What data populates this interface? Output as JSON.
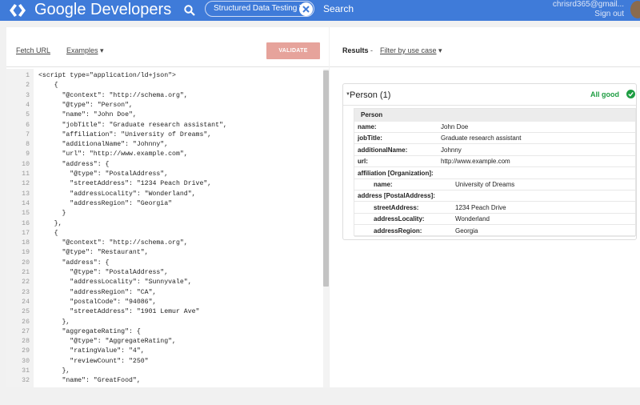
{
  "header": {
    "logo_text": "Google Developers",
    "tab_label": "Structured Data Testing T...",
    "search_label": "Search",
    "account_email": "chrisrd365@gmail...",
    "sign_out": "Sign out",
    "brand_color": "#3f7bd9"
  },
  "left": {
    "fetch_url": "Fetch URL",
    "examples": "Examples",
    "validate": "VALIDATE",
    "code_lines": [
      {
        "n": "1",
        "t": "<script type=\"application/ld+json\">"
      },
      {
        "n": "2",
        "t": "    {"
      },
      {
        "n": "3",
        "t": "      \"@context\": \"http://schema.org\","
      },
      {
        "n": "4",
        "t": "      \"@type\": \"Person\","
      },
      {
        "n": "5",
        "t": "      \"name\": \"John Doe\","
      },
      {
        "n": "6",
        "t": "      \"jobTitle\": \"Graduate research assistant\","
      },
      {
        "n": "7",
        "t": "      \"affiliation\": \"University of Dreams\","
      },
      {
        "n": "8",
        "t": "      \"additionalName\": \"Johnny\","
      },
      {
        "n": "9",
        "t": "      \"url\": \"http://www.example.com\","
      },
      {
        "n": "10",
        "t": "      \"address\": {"
      },
      {
        "n": "11",
        "t": "        \"@type\": \"PostalAddress\","
      },
      {
        "n": "12",
        "t": "        \"streetAddress\": \"1234 Peach Drive\","
      },
      {
        "n": "13",
        "t": "        \"addressLocality\": \"Wonderland\","
      },
      {
        "n": "14",
        "t": "        \"addressRegion\": \"Georgia\""
      },
      {
        "n": "15",
        "t": "      }"
      },
      {
        "n": "16",
        "t": "    },"
      },
      {
        "n": "17",
        "t": "    {"
      },
      {
        "n": "18",
        "t": "      \"@context\": \"http://schema.org\","
      },
      {
        "n": "19",
        "t": "      \"@type\": \"Restaurant\","
      },
      {
        "n": "20",
        "t": "      \"address\": {"
      },
      {
        "n": "21",
        "t": "        \"@type\": \"PostalAddress\","
      },
      {
        "n": "22",
        "t": "        \"addressLocality\": \"Sunnyvale\","
      },
      {
        "n": "23",
        "t": "        \"addressRegion\": \"CA\","
      },
      {
        "n": "24",
        "t": "        \"postalCode\": \"94086\","
      },
      {
        "n": "25",
        "t": "        \"streetAddress\": \"1901 Lemur Ave\""
      },
      {
        "n": "26",
        "t": "      },"
      },
      {
        "n": "27",
        "t": "      \"aggregateRating\": {"
      },
      {
        "n": "28",
        "t": "        \"@type\": \"AggregateRating\","
      },
      {
        "n": "29",
        "t": "        \"ratingValue\": \"4\","
      },
      {
        "n": "30",
        "t": "        \"reviewCount\": \"250\""
      },
      {
        "n": "31",
        "t": "      },"
      },
      {
        "n": "32",
        "t": "      \"name\": \"GreatFood\","
      }
    ]
  },
  "right": {
    "results": "Results",
    "separator": "-",
    "filter": "Filter by use case",
    "card_title": "Person (1)",
    "status": "All good",
    "status_color": "#1e9d42",
    "type_label": "Person",
    "rows": [
      {
        "key": "name:",
        "value": "John Doe",
        "level": 0
      },
      {
        "key": "jobTitle:",
        "value": "Graduate research assistant",
        "level": 0
      },
      {
        "key": "additionalName:",
        "value": "Johnny",
        "level": 0
      },
      {
        "key": "url:",
        "value": "http://www.example.com",
        "level": 0
      },
      {
        "key": "affiliation [Organization]:",
        "value": "",
        "level": 0
      },
      {
        "key": "name:",
        "value": "University of Dreams",
        "level": 1
      },
      {
        "key": "address [PostalAddress]:",
        "value": "",
        "level": 0
      },
      {
        "key": "streetAddress:",
        "value": "1234 Peach Drive",
        "level": 1
      },
      {
        "key": "addressLocality:",
        "value": "Wonderland",
        "level": 1
      },
      {
        "key": "addressRegion:",
        "value": "Georgia",
        "level": 1
      }
    ]
  }
}
